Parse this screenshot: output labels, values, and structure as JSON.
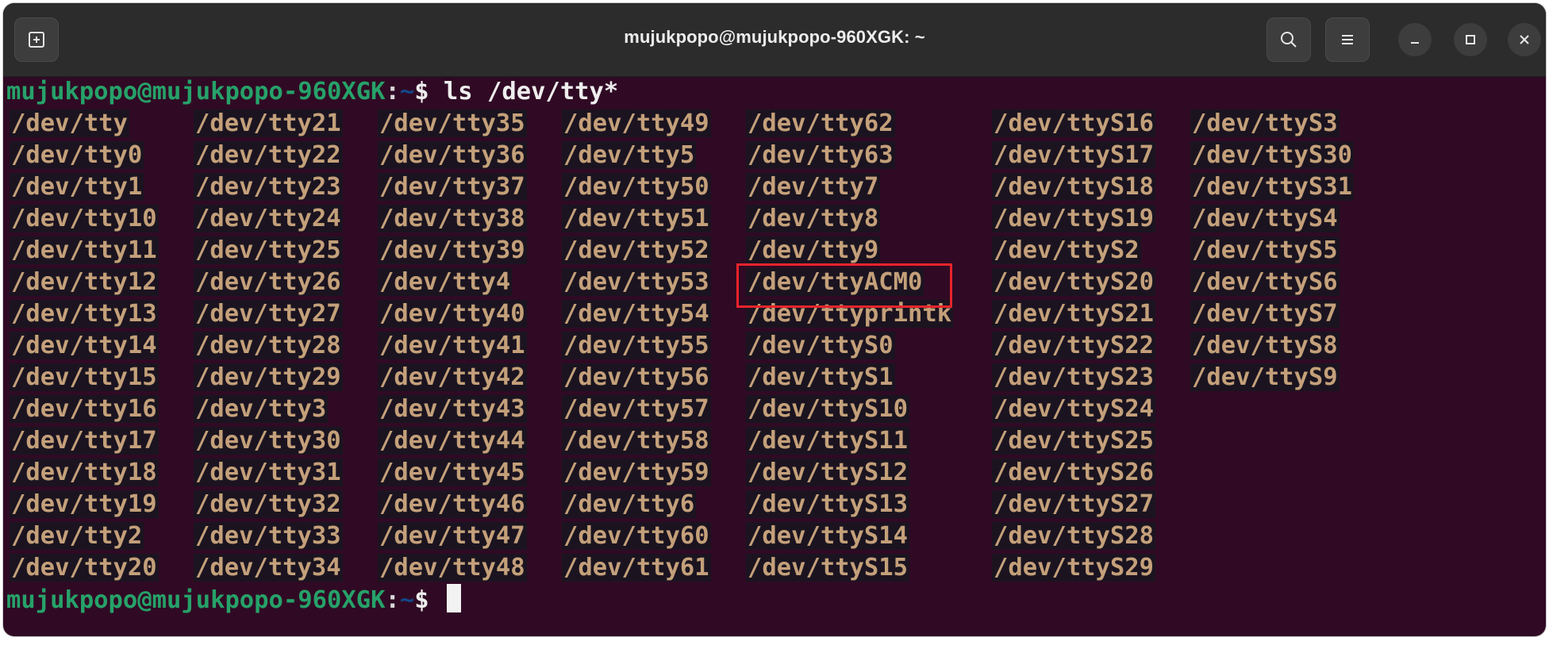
{
  "window": {
    "title": "mujukpopo@mujukpopo-960XGK: ~",
    "new_tab_icon": "new-tab-icon",
    "search_icon": "search-icon",
    "menu_icon": "hamburger-menu-icon",
    "minimize_icon": "minimize-icon",
    "maximize_icon": "maximize-icon",
    "close_icon": "close-icon"
  },
  "prompt": {
    "user_host": "mujukpopo@mujukpopo-960XGK",
    "sep": ":",
    "path": "~",
    "dollar": "$ ",
    "command": "ls /dev/tty*"
  },
  "listing": {
    "columns": [
      [
        "/dev/tty",
        "/dev/tty0",
        "/dev/tty1",
        "/dev/tty10",
        "/dev/tty11",
        "/dev/tty12",
        "/dev/tty13",
        "/dev/tty14",
        "/dev/tty15",
        "/dev/tty16",
        "/dev/tty17",
        "/dev/tty18",
        "/dev/tty19",
        "/dev/tty2",
        "/dev/tty20"
      ],
      [
        "/dev/tty21",
        "/dev/tty22",
        "/dev/tty23",
        "/dev/tty24",
        "/dev/tty25",
        "/dev/tty26",
        "/dev/tty27",
        "/dev/tty28",
        "/dev/tty29",
        "/dev/tty3",
        "/dev/tty30",
        "/dev/tty31",
        "/dev/tty32",
        "/dev/tty33",
        "/dev/tty34"
      ],
      [
        "/dev/tty35",
        "/dev/tty36",
        "/dev/tty37",
        "/dev/tty38",
        "/dev/tty39",
        "/dev/tty4",
        "/dev/tty40",
        "/dev/tty41",
        "/dev/tty42",
        "/dev/tty43",
        "/dev/tty44",
        "/dev/tty45",
        "/dev/tty46",
        "/dev/tty47",
        "/dev/tty48"
      ],
      [
        "/dev/tty49",
        "/dev/tty5",
        "/dev/tty50",
        "/dev/tty51",
        "/dev/tty52",
        "/dev/tty53",
        "/dev/tty54",
        "/dev/tty55",
        "/dev/tty56",
        "/dev/tty57",
        "/dev/tty58",
        "/dev/tty59",
        "/dev/tty6",
        "/dev/tty60",
        "/dev/tty61"
      ],
      [
        "/dev/tty62",
        "/dev/tty63",
        "/dev/tty7",
        "/dev/tty8",
        "/dev/tty9",
        "/dev/ttyACM0",
        "/dev/ttyprintk",
        "/dev/ttyS0",
        "/dev/ttyS1",
        "/dev/ttyS10",
        "/dev/ttyS11",
        "/dev/ttyS12",
        "/dev/ttyS13",
        "/dev/ttyS14",
        "/dev/ttyS15"
      ],
      [
        "/dev/ttyS16",
        "/dev/ttyS17",
        "/dev/ttyS18",
        "/dev/ttyS19",
        "/dev/ttyS2",
        "/dev/ttyS20",
        "/dev/ttyS21",
        "/dev/ttyS22",
        "/dev/ttyS23",
        "/dev/ttyS24",
        "/dev/ttyS25",
        "/dev/ttyS26",
        "/dev/ttyS27",
        "/dev/ttyS28",
        "/dev/ttyS29"
      ],
      [
        "/dev/ttyS3",
        "/dev/ttyS30",
        "/dev/ttyS31",
        "/dev/ttyS4",
        "/dev/ttyS5",
        "/dev/ttyS6",
        "/dev/ttyS7",
        "/dev/ttyS8",
        "/dev/ttyS9"
      ]
    ],
    "highlighted": "/dev/ttyACM0"
  },
  "colors": {
    "terminal_bg": "#300a24",
    "prompt_user": "#26a269",
    "prompt_path": "#12488b",
    "entry_text": "#c4a07a",
    "highlight_box": "#e8242b"
  }
}
